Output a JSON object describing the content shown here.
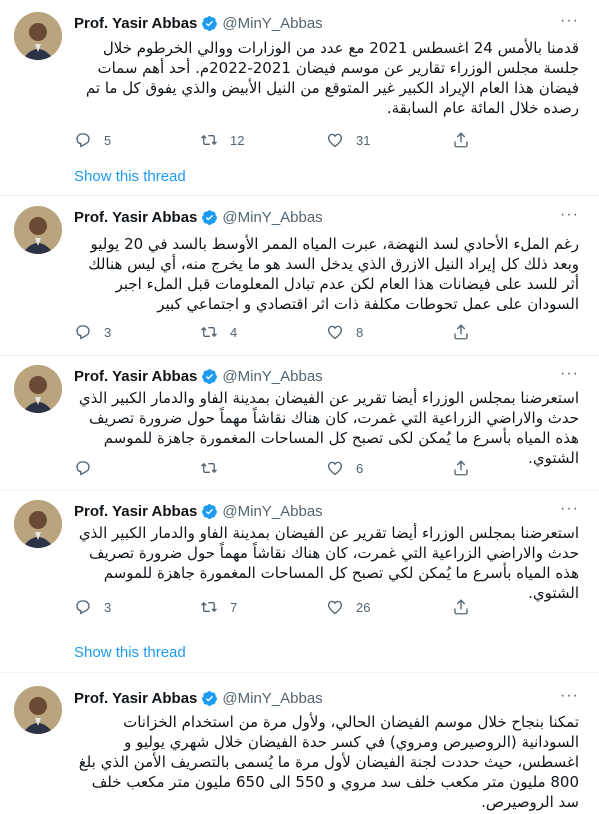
{
  "tweets": [
    {
      "name": "Prof. Yasir Abbas",
      "handle": "@MinY_Abbas",
      "text": "قدمنا بالأمس 24 اغسطس 2021 مع عدد من الوزارات ووالي الخرطوم خلال جلسة مجلس الوزراء تقارير عن موسم فيضان 2021-2022م. أحد أهم سمات فيضان هذا العام الإيراد الكبير غير المتوقع من النيل الأبيض والذي يفوق كل ما تم رصده خلال المائة عام السابقة.",
      "replies": "5",
      "retweets": "12",
      "likes": "31",
      "show_thread": "Show this thread"
    },
    {
      "name": "Prof. Yasir Abbas",
      "handle": "@MinY_Abbas",
      "text": "رغم الملء الأحادي لسد النهضة، عبرت المياه الممر الأوسط بالسد في 20 يوليو وبعد ذلك كل إيراد النيل الازرق الذي يدخل السد هو ما يخرج منه، أي ليس هنالك أثر للسد على فيضانات هذا العام لكن عدم تبادل المعلومات قبل الملء اجبر السودان على عمل تحوطات مكلفة ذات اثر  اقتصادي و اجتماعي كبير",
      "replies": "3",
      "retweets": "4",
      "likes": "8"
    },
    {
      "name": "Prof. Yasir Abbas",
      "handle": "@MinY_Abbas",
      "text": "استعرضنا بمجلس الوزراء أيضا تقرير عن الفيضان بمدينة الفاو والدمار الكبير الذي حدث والاراضي الزراعية التي غمرت، كان هناك نقاشاً مهماً حول ضرورة تصريف هذه المياه بأسرع ما يُمكن لكى تصبح كل المساحات المغمورة جاهزة للموسم الشتوي.",
      "replies": "",
      "retweets": "",
      "likes": "6"
    },
    {
      "name": "Prof. Yasir Abbas",
      "handle": "@MinY_Abbas",
      "text": "استعرضنا بمجلس الوزراء أيضا تقرير عن الفيضان بمدينة الفاو والدمار الكبير الذي حدث والاراضي الزراعية التي غمرت، كان هناك نقاشاً مهماً حول ضرورة تصريف هذه المياه بأسرع ما يُمكن لكي تصبح كل المساحات المغمورة جاهزة للموسم الشتوي.",
      "replies": "3",
      "retweets": "7",
      "likes": "26",
      "show_thread": "Show this thread"
    },
    {
      "name": "Prof. Yasir Abbas",
      "handle": "@MinY_Abbas",
      "text": "تمكنا بنجاح خلال موسم الفيضان الحالي، ولأول مرة من استخدام الخزانات السودانية (الروصيرص ومروي) في كسر حدة الفيضان خلال شهري يوليو و اغسطس، حيث حددت لجنة الفيضان لأول مرة ما يُسمى بالتصريف الأمن الذي بلغ 800 مليون متر مكعب خلف سد مروي و 550 الى 650 مليون متر مكعب خلف سد الروصيرص."
    }
  ],
  "colors": {
    "accent": "#1d9bf0",
    "muted": "#536471",
    "text": "#0f1419"
  }
}
